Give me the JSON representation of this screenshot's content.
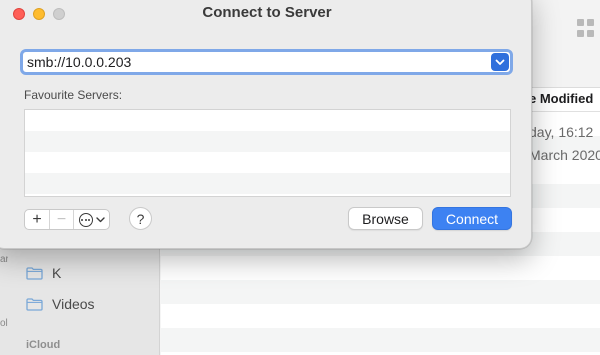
{
  "dialog": {
    "title": "Connect to Server",
    "address": {
      "value": "smb://10.0.0.203",
      "placeholder": ""
    },
    "favourites_label": "Favourite Servers:",
    "favourites": [],
    "buttons": {
      "add": "+",
      "remove": "−",
      "help": "?",
      "browse": "Browse",
      "connect": "Connect"
    }
  },
  "finder": {
    "column_header": "e Modified",
    "dates": [
      "day, 16:12",
      "March 2020"
    ],
    "sidebar": {
      "items": [
        {
          "label": "K",
          "icon": "folder-icon"
        },
        {
          "label": "Videos",
          "icon": "folder-icon"
        }
      ],
      "section": "iCloud",
      "edge_fragments": [
        "ar",
        "ol"
      ]
    }
  },
  "colors": {
    "accent": "#3d82f2",
    "focus_ring": "#7fa8e8",
    "close": "#ff5f57",
    "minimize": "#febc2e",
    "zoom_inactive": "#cfcfcf"
  }
}
